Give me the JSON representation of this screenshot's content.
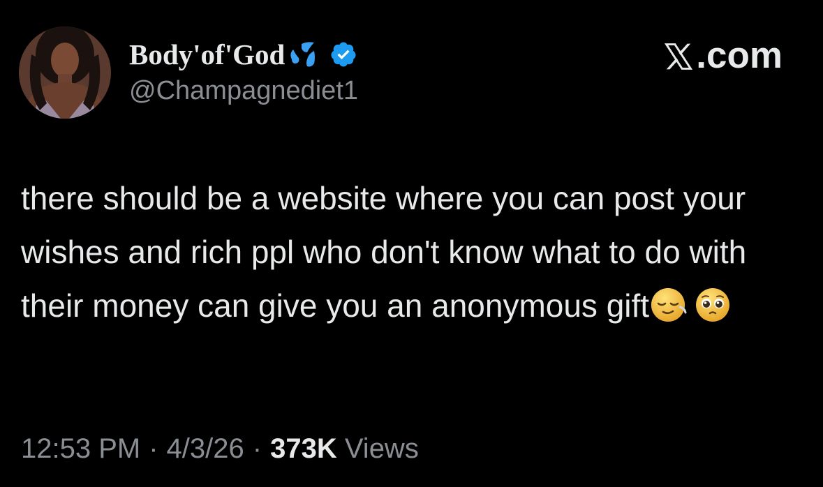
{
  "profile": {
    "display_name": "Body'of'God",
    "handle": "@Champagnediet1",
    "verified": true
  },
  "brand": {
    "label": ".com"
  },
  "tweet": {
    "text": "there should be a website where you can post your wishes and rich ppl who don't know what to do with their money can give you an anonymous gift",
    "emojis": [
      "relieved-face-emoji",
      "pleading-face-emoji"
    ]
  },
  "meta": {
    "time": "12:53 PM",
    "date": "4/3/26",
    "views_count": "373K",
    "views_label": "Views",
    "separator": "·"
  },
  "colors": {
    "background": "#000000",
    "text_primary": "#e7e9ea",
    "text_secondary": "#8b8f94",
    "verified_blue": "#1d9bf0",
    "sweat_drops_blue": "#3aa0f3"
  }
}
